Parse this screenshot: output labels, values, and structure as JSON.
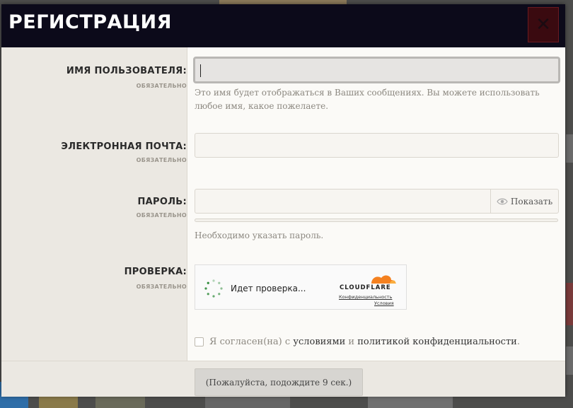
{
  "modal": {
    "title": "РЕГИСТРАЦИЯ",
    "close_label": "✕"
  },
  "fields": {
    "username": {
      "label": "ИМЯ ПОЛЬЗОВАТЕЛЯ:",
      "required": "ОБЯЗАТЕЛЬНО",
      "value": "",
      "hint": "Это имя будет отображаться в Ваших сообщениях. Вы можете использовать любое имя, какое пожелаете."
    },
    "email": {
      "label": "ЭЛЕКТРОННАЯ ПОЧТА:",
      "required": "ОБЯЗАТЕЛЬНО",
      "value": ""
    },
    "password": {
      "label": "ПАРОЛЬ:",
      "required": "ОБЯЗАТЕЛЬНО",
      "value": "",
      "show_label": "Показать",
      "hint": "Необходимо указать пароль."
    },
    "verification": {
      "label": "ПРОВЕРКА:",
      "required": "ОБЯЗАТЕЛЬНО",
      "status": "Идет проверка...",
      "provider": "CLOUDFLARE",
      "privacy_link": "Конфиденциальность",
      "terms_link": "Условия"
    }
  },
  "agreement": {
    "prefix": "Я согласен(на) с ",
    "terms": "условиями",
    "middle": " и ",
    "privacy": "политикой конфиденциальности",
    "suffix": "."
  },
  "submit": {
    "label": "(Пожалуйста, подождите 9 сек.)"
  },
  "colors": {
    "header_bg": "#0c0a1a",
    "close_bg": "#3a0a10",
    "cloudflare_orange": "#f48120",
    "spinner_green": "#2e8b3a"
  }
}
